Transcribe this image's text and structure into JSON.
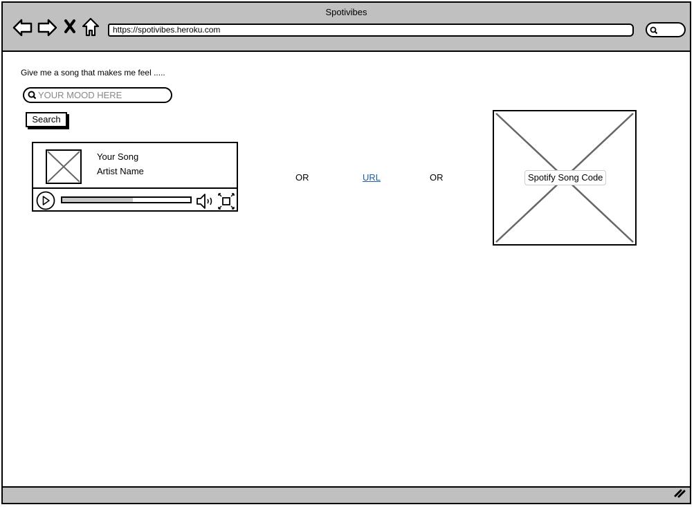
{
  "window": {
    "title": "Spotivibes",
    "url": "https://spotivibes.heroku.com",
    "nav_icons": [
      "back-arrow-icon",
      "forward-arrow-icon",
      "close-x-icon",
      "home-icon"
    ]
  },
  "main": {
    "prompt": "Give me a song that makes me feel .....",
    "mood_input": {
      "placeholder": "YOUR MOOD HERE",
      "value": ""
    },
    "search_button": "Search",
    "player": {
      "song_title": "Your Song",
      "artist_name": "Artist Name",
      "progress": 0.55
    },
    "or_left": "OR",
    "url_link": "URL",
    "or_right": "OR",
    "song_code_label": "Spotify Song Code"
  }
}
